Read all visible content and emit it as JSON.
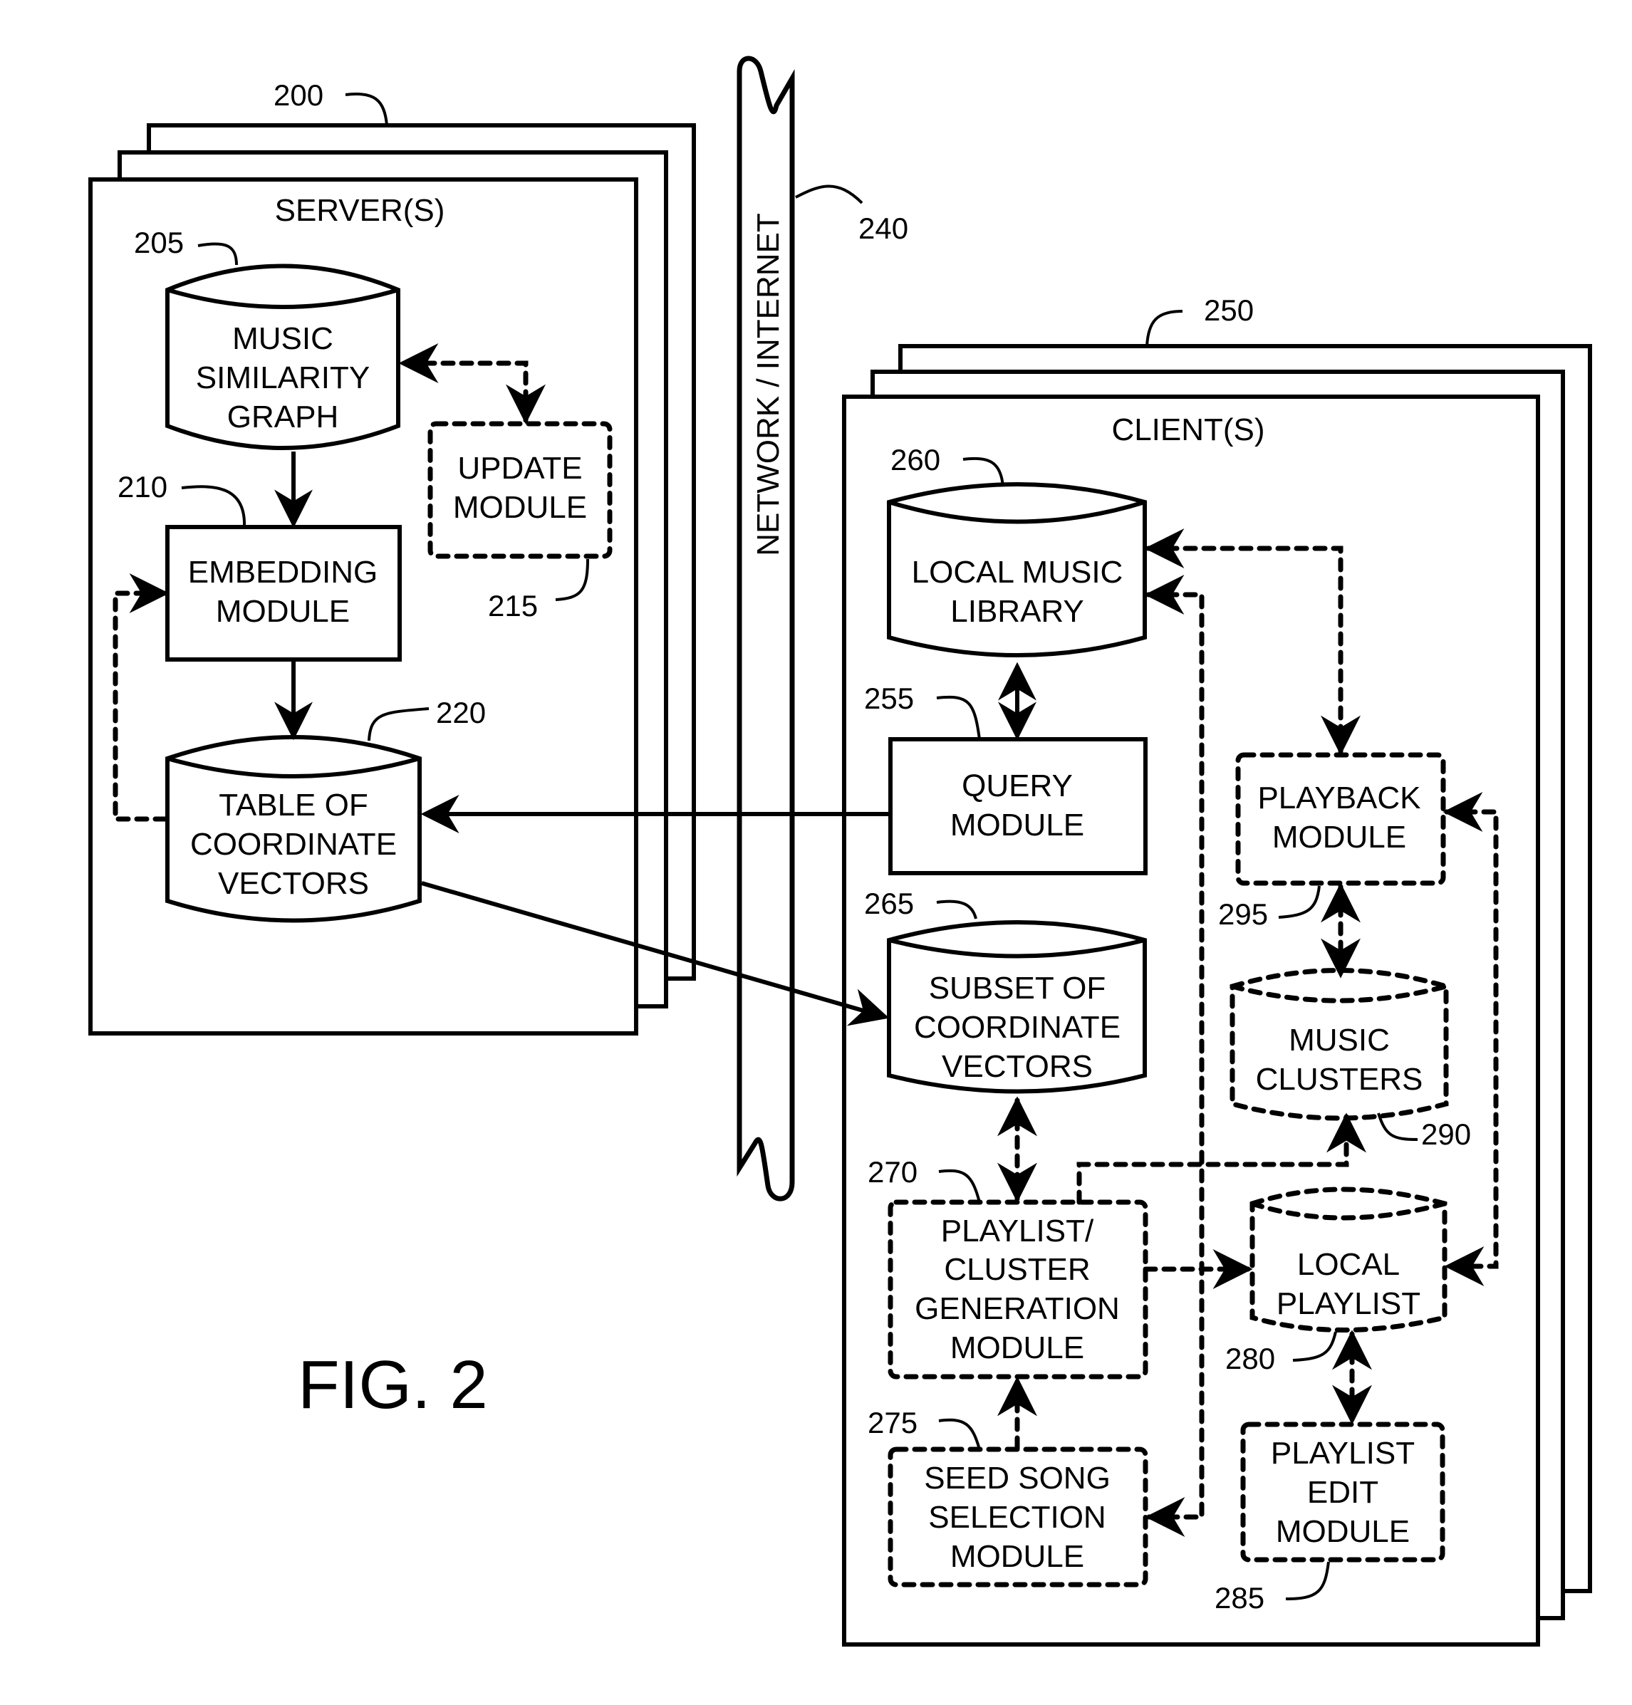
{
  "figure": {
    "caption": "FIG. 2"
  },
  "server": {
    "title": "SERVER(S)",
    "ref": "200",
    "components": {
      "music_similarity_graph": {
        "lines": [
          "MUSIC",
          "SIMILARITY",
          "GRAPH"
        ],
        "ref": "205",
        "shape": "database",
        "style": "solid"
      },
      "embedding_module": {
        "lines": [
          "EMBEDDING",
          "MODULE"
        ],
        "ref": "210",
        "shape": "box",
        "style": "solid"
      },
      "update_module": {
        "lines": [
          "UPDATE",
          "MODULE"
        ],
        "ref": "215",
        "shape": "box",
        "style": "dashed"
      },
      "table_of_coordinate_vectors": {
        "lines": [
          "TABLE OF",
          "COORDINATE",
          "VECTORS"
        ],
        "ref": "220",
        "shape": "database",
        "style": "solid"
      }
    }
  },
  "network": {
    "label": "NETWORK / INTERNET",
    "ref": "240"
  },
  "client": {
    "title": "CLIENT(S)",
    "ref": "250",
    "components": {
      "query_module": {
        "lines": [
          "QUERY",
          "MODULE"
        ],
        "ref": "255",
        "shape": "box",
        "style": "solid"
      },
      "local_music_library": {
        "lines": [
          "LOCAL MUSIC",
          "LIBRARY"
        ],
        "ref": "260",
        "shape": "database",
        "style": "solid"
      },
      "subset_of_coordinate_vectors": {
        "lines": [
          "SUBSET OF",
          "COORDINATE",
          "VECTORS"
        ],
        "ref": "265",
        "shape": "database",
        "style": "solid"
      },
      "playlist_cluster_generation_module": {
        "lines": [
          "PLAYLIST/",
          "CLUSTER",
          "GENERATION",
          "MODULE"
        ],
        "ref": "270",
        "shape": "box",
        "style": "dashed"
      },
      "seed_song_selection_module": {
        "lines": [
          "SEED SONG",
          "SELECTION",
          "MODULE"
        ],
        "ref": "275",
        "shape": "box",
        "style": "dashed"
      },
      "local_playlist": {
        "lines": [
          "LOCAL",
          "PLAYLIST"
        ],
        "ref": "280",
        "shape": "database",
        "style": "dashed"
      },
      "playlist_edit_module": {
        "lines": [
          "PLAYLIST",
          "EDIT",
          "MODULE"
        ],
        "ref": "285",
        "shape": "box",
        "style": "dashed"
      },
      "music_clusters": {
        "lines": [
          "MUSIC",
          "CLUSTERS"
        ],
        "ref": "290",
        "shape": "database",
        "style": "dashed"
      },
      "playback_module": {
        "lines": [
          "PLAYBACK",
          "MODULE"
        ],
        "ref": "295",
        "shape": "box",
        "style": "dashed"
      }
    }
  },
  "connections": [
    {
      "from": "music_similarity_graph",
      "to": "embedding_module",
      "style": "solid",
      "direction": "forward"
    },
    {
      "from": "update_module",
      "to": "music_similarity_graph",
      "style": "dashed",
      "direction": "both"
    },
    {
      "from": "embedding_module",
      "to": "table_of_coordinate_vectors",
      "style": "solid",
      "direction": "forward"
    },
    {
      "from": "table_of_coordinate_vectors",
      "to": "embedding_module",
      "style": "dashed",
      "direction": "forward"
    },
    {
      "from": "query_module",
      "to": "table_of_coordinate_vectors",
      "style": "solid",
      "direction": "forward"
    },
    {
      "from": "table_of_coordinate_vectors",
      "to": "subset_of_coordinate_vectors",
      "style": "solid",
      "direction": "forward"
    },
    {
      "from": "local_music_library",
      "to": "query_module",
      "style": "solid",
      "direction": "both"
    },
    {
      "from": "local_music_library",
      "to": "playback_module",
      "style": "dashed",
      "direction": "both"
    },
    {
      "from": "seed_song_selection_module",
      "to": "local_music_library",
      "style": "dashed",
      "direction": "both"
    },
    {
      "from": "subset_of_coordinate_vectors",
      "to": "playlist_cluster_generation_module",
      "style": "dashed",
      "direction": "both"
    },
    {
      "from": "seed_song_selection_module",
      "to": "playlist_cluster_generation_module",
      "style": "dashed",
      "direction": "forward"
    },
    {
      "from": "playlist_cluster_generation_module",
      "to": "music_clusters",
      "style": "dashed",
      "direction": "forward"
    },
    {
      "from": "playlist_cluster_generation_module",
      "to": "local_playlist",
      "style": "dashed",
      "direction": "forward"
    },
    {
      "from": "playback_module",
      "to": "music_clusters",
      "style": "dashed",
      "direction": "both"
    },
    {
      "from": "playback_module",
      "to": "local_playlist",
      "style": "dashed",
      "direction": "both"
    },
    {
      "from": "local_playlist",
      "to": "playlist_edit_module",
      "style": "dashed",
      "direction": "both"
    }
  ]
}
